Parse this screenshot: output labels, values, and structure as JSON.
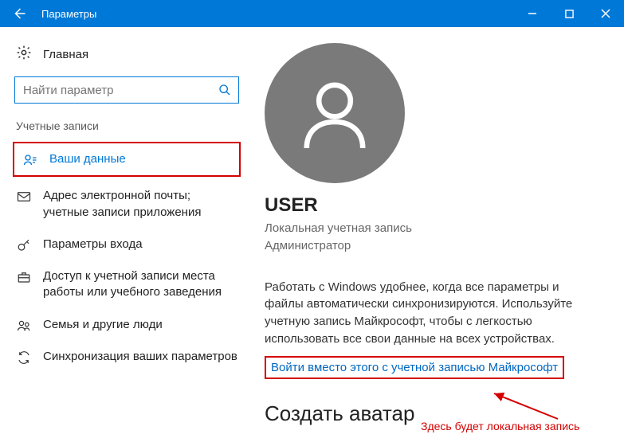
{
  "window": {
    "title": "Параметры"
  },
  "sidebar": {
    "home": "Главная",
    "search_placeholder": "Найти параметр",
    "section_label": "Учетные записи",
    "items": [
      {
        "label": "Ваши данные"
      },
      {
        "label": "Адрес электронной почты; учетные записи приложения"
      },
      {
        "label": "Параметры входа"
      },
      {
        "label": "Доступ к учетной записи места работы или учебного заведения"
      },
      {
        "label": "Семья и другие люди"
      },
      {
        "label": "Синхронизация ваших параметров"
      }
    ]
  },
  "account": {
    "name": "USER",
    "type": "Локальная учетная запись",
    "role": "Администратор",
    "description": "Работать с Windows удобнее, когда все параметры и файлы автоматически синхронизируются. Используйте учетную запись Майкрософт, чтобы с легкостью использовать все свои данные на всех устройствах.",
    "ms_link": "Войти вместо этого с учетной записью Майкрософт",
    "avatar_heading": "Создать аватар"
  },
  "annotation": {
    "text": "Здесь будет локальная запись"
  },
  "colors": {
    "accent": "#0078d7",
    "annotation": "#d40000"
  }
}
